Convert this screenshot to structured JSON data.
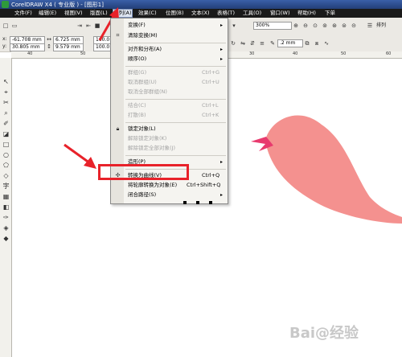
{
  "window": {
    "title": "CorelDRAW X4 ( 专业版 ) - [图形1]"
  },
  "menubar": [
    "文件(F)",
    "编辑(E)",
    "视图(V)",
    "版面(L)",
    "排列(A)",
    "效果(C)",
    "位图(B)",
    "文本(X)",
    "表格(T)",
    "工具(O)",
    "窗口(W)",
    "帮助(H)",
    "下单"
  ],
  "toolbar": {
    "zoom": "300%",
    "x": "-61.708 mm",
    "y": "30.805 mm",
    "width": "6.725 mm",
    "height": "9.579 mm",
    "scale_w": "100.0",
    "scale_h": "100.0",
    "outline_width": ".2 mm",
    "arrange_label": "排列"
  },
  "ruler": {
    "h_ticks": [
      "40",
      "50",
      "30",
      "40",
      "50",
      "60"
    ]
  },
  "dropdown": {
    "items": [
      {
        "label": "变换(F)",
        "shortcut": "",
        "submenu": true,
        "disabled": false
      },
      {
        "label": "清除变换(M)",
        "shortcut": "",
        "submenu": false,
        "disabled": false
      },
      {
        "label": "对齐和分布(A)",
        "shortcut": "",
        "submenu": true,
        "disabled": false
      },
      {
        "label": "顺序(O)",
        "shortcut": "",
        "submenu": true,
        "disabled": false
      },
      {
        "label": "群组(G)",
        "shortcut": "Ctrl+G",
        "submenu": false,
        "disabled": true
      },
      {
        "label": "取消群组(U)",
        "shortcut": "Ctrl+U",
        "submenu": false,
        "disabled": true
      },
      {
        "label": "取消全部群组(N)",
        "shortcut": "",
        "submenu": false,
        "disabled": true
      },
      {
        "label": "结合(C)",
        "shortcut": "Ctrl+L",
        "submenu": false,
        "disabled": true
      },
      {
        "label": "打散(B)",
        "shortcut": "Ctrl+K",
        "submenu": false,
        "disabled": true
      },
      {
        "label": "锁定对象(L)",
        "shortcut": "",
        "submenu": false,
        "disabled": false
      },
      {
        "label": "解除锁定对象(K)",
        "shortcut": "",
        "submenu": false,
        "disabled": true
      },
      {
        "label": "解除锁定全部对象(J)",
        "shortcut": "",
        "submenu": false,
        "disabled": true
      },
      {
        "label": "造形(P)",
        "shortcut": "",
        "submenu": true,
        "disabled": false
      },
      {
        "label": "转换为曲线(V)",
        "shortcut": "Ctrl+Q",
        "submenu": false,
        "disabled": false
      },
      {
        "label": "将轮廓转换为对象(E)",
        "shortcut": "Ctrl+Shift+Q",
        "submenu": false,
        "disabled": false
      },
      {
        "label": "闭合路径(S)",
        "shortcut": "",
        "submenu": true,
        "disabled": false
      }
    ]
  },
  "colors": {
    "shape_fill": "#f4918f",
    "beak": "#e83a6e",
    "arrow": "#e8222a",
    "highlight": "#e8222a"
  },
  "watermark": "Bai@经验"
}
